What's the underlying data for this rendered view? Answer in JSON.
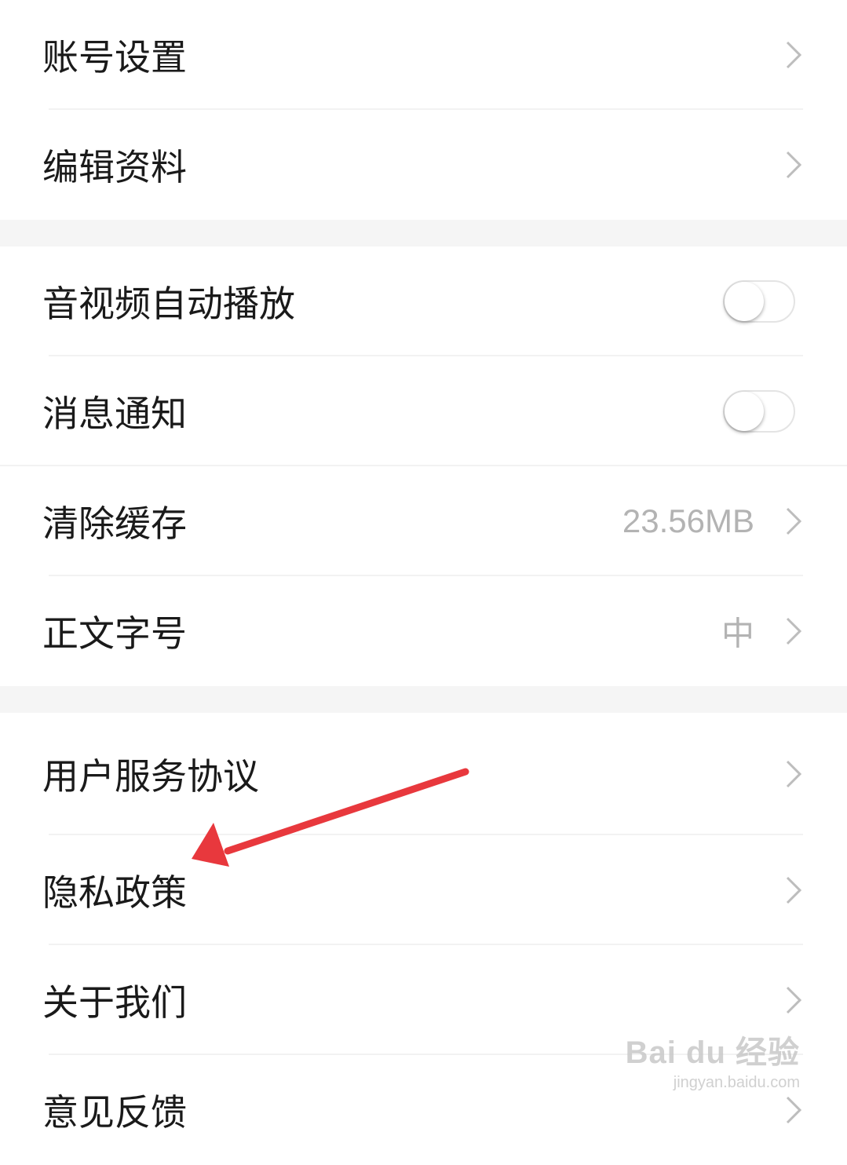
{
  "groups": [
    {
      "items": [
        {
          "label": "账号设置",
          "type": "link"
        },
        {
          "label": "编辑资料",
          "type": "link"
        }
      ]
    },
    {
      "items": [
        {
          "label": "音视频自动播放",
          "type": "toggle",
          "on": false
        },
        {
          "label": "消息通知",
          "type": "toggle",
          "on": false
        },
        {
          "label": "清除缓存",
          "type": "link",
          "value": "23.56MB"
        },
        {
          "label": "正文字号",
          "type": "link",
          "value": "中"
        }
      ]
    },
    {
      "items": [
        {
          "label": "用户服务协议",
          "type": "link"
        },
        {
          "label": "隐私政策",
          "type": "link"
        },
        {
          "label": "关于我们",
          "type": "link"
        },
        {
          "label": "意见反馈",
          "type": "link"
        }
      ]
    }
  ],
  "annotation": {
    "color": "#e8383d",
    "points_to": "隐私政策"
  },
  "watermark": {
    "main": "Bai du 经验",
    "sub": "jingyan.baidu.com"
  }
}
